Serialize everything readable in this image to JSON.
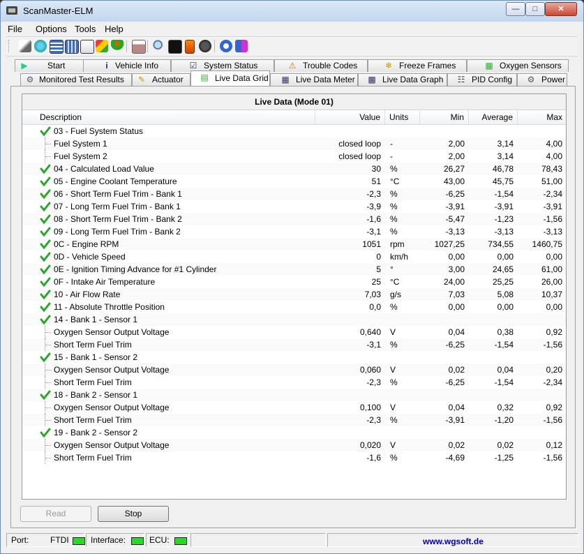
{
  "window": {
    "title": "ScanMaster-ELM"
  },
  "menu": [
    "File",
    "Options",
    "Tools",
    "Help"
  ],
  "toolbar_icons": [
    "connect-icon",
    "globe-icon",
    "grid-icon",
    "table-icon",
    "chart-icon",
    "flag-icon",
    "person-icon",
    "clipboard-icon",
    "zoom-icon",
    "terminal-icon",
    "battery-icon",
    "gauge-icon",
    "info-icon",
    "book-icon"
  ],
  "tabs_top": [
    {
      "label": "Start",
      "icon": "start-icon"
    },
    {
      "label": "Vehicle Info",
      "icon": "info-icon"
    },
    {
      "label": "System Status",
      "icon": "checkbox-icon"
    },
    {
      "label": "Trouble Codes",
      "icon": "warning-icon"
    },
    {
      "label": "Freeze Frames",
      "icon": "snowflake-icon"
    },
    {
      "label": "Oxygen Sensors",
      "icon": "sensor-icon"
    }
  ],
  "tabs_bottom": [
    {
      "label": "Monitored Test Results",
      "icon": "gear-icon"
    },
    {
      "label": "Actuator",
      "icon": "actuator-icon"
    },
    {
      "label": "Live Data Grid",
      "icon": "grid-icon",
      "active": true
    },
    {
      "label": "Live Data Meter",
      "icon": "meter-icon"
    },
    {
      "label": "Live Data Graph",
      "icon": "graph-icon"
    },
    {
      "label": "PID Config",
      "icon": "config-icon"
    },
    {
      "label": "Power",
      "icon": "power-icon"
    }
  ],
  "grid": {
    "title": "Live Data (Mode 01)",
    "columns": {
      "description": "Description",
      "value": "Value",
      "units": "Units",
      "min": "Min",
      "average": "Average",
      "max": "Max"
    },
    "rows": [
      {
        "type": "group",
        "desc": "03 - Fuel System Status",
        "value": "",
        "unit": "",
        "min": "",
        "avg": "",
        "max": ""
      },
      {
        "type": "child",
        "desc": "Fuel System 1",
        "value": "closed loop",
        "unit": "-",
        "min": "2,00",
        "avg": "3,14",
        "max": "4,00"
      },
      {
        "type": "child",
        "desc": "Fuel System 2",
        "value": "closed loop",
        "unit": "-",
        "min": "2,00",
        "avg": "3,14",
        "max": "4,00"
      },
      {
        "type": "group",
        "desc": "04 - Calculated Load Value",
        "value": "30",
        "unit": "%",
        "min": "26,27",
        "avg": "46,78",
        "max": "78,43"
      },
      {
        "type": "group",
        "desc": "05 - Engine Coolant Temperature",
        "value": "51",
        "unit": "°C",
        "min": "43,00",
        "avg": "45,75",
        "max": "51,00"
      },
      {
        "type": "group",
        "desc": "06 - Short Term Fuel Trim - Bank 1",
        "value": "-2,3",
        "unit": "%",
        "min": "-6,25",
        "avg": "-1,54",
        "max": "-2,34"
      },
      {
        "type": "group",
        "desc": "07 - Long Term Fuel Trim - Bank 1",
        "value": "-3,9",
        "unit": "%",
        "min": "-3,91",
        "avg": "-3,91",
        "max": "-3,91"
      },
      {
        "type": "group",
        "desc": "08 - Short Term Fuel Trim - Bank 2",
        "value": "-1,6",
        "unit": "%",
        "min": "-5,47",
        "avg": "-1,23",
        "max": "-1,56"
      },
      {
        "type": "group",
        "desc": "09 - Long Term Fuel Trim - Bank 2",
        "value": "-3,1",
        "unit": "%",
        "min": "-3,13",
        "avg": "-3,13",
        "max": "-3,13"
      },
      {
        "type": "group",
        "desc": "0C - Engine RPM",
        "value": "1051",
        "unit": "rpm",
        "min": "1027,25",
        "avg": "734,55",
        "max": "1460,75"
      },
      {
        "type": "group",
        "desc": "0D - Vehicle Speed",
        "value": "0",
        "unit": "km/h",
        "min": "0,00",
        "avg": "0,00",
        "max": "0,00"
      },
      {
        "type": "group",
        "desc": "0E - Ignition Timing Advance for #1 Cylinder",
        "value": "5",
        "unit": "°",
        "min": "3,00",
        "avg": "24,65",
        "max": "61,00"
      },
      {
        "type": "group",
        "desc": "0F - Intake Air Temperature",
        "value": "25",
        "unit": "°C",
        "min": "24,00",
        "avg": "25,25",
        "max": "26,00"
      },
      {
        "type": "group",
        "desc": "10 - Air Flow Rate",
        "value": "7,03",
        "unit": "g/s",
        "min": "7,03",
        "avg": "5,08",
        "max": "10,37"
      },
      {
        "type": "group",
        "desc": "11 - Absolute Throttle Position",
        "value": "0,0",
        "unit": "%",
        "min": "0,00",
        "avg": "0,00",
        "max": "0,00"
      },
      {
        "type": "group",
        "desc": "14 - Bank 1 - Sensor 1",
        "value": "",
        "unit": "",
        "min": "",
        "avg": "",
        "max": ""
      },
      {
        "type": "child",
        "desc": "Oxygen Sensor Output Voltage",
        "value": "0,640",
        "unit": "V",
        "min": "0,04",
        "avg": "0,38",
        "max": "0,92"
      },
      {
        "type": "child",
        "desc": "Short Term Fuel Trim",
        "value": "-3,1",
        "unit": "%",
        "min": "-6,25",
        "avg": "-1,54",
        "max": "-1,56"
      },
      {
        "type": "group",
        "desc": "15 - Bank 1 - Sensor 2",
        "value": "",
        "unit": "",
        "min": "",
        "avg": "",
        "max": ""
      },
      {
        "type": "child",
        "desc": "Oxygen Sensor Output Voltage",
        "value": "0,060",
        "unit": "V",
        "min": "0,02",
        "avg": "0,04",
        "max": "0,20"
      },
      {
        "type": "child",
        "desc": "Short Term Fuel Trim",
        "value": "-2,3",
        "unit": "%",
        "min": "-6,25",
        "avg": "-1,54",
        "max": "-2,34"
      },
      {
        "type": "group",
        "desc": "18 - Bank 2 - Sensor 1",
        "value": "",
        "unit": "",
        "min": "",
        "avg": "",
        "max": ""
      },
      {
        "type": "child",
        "desc": "Oxygen Sensor Output Voltage",
        "value": "0,100",
        "unit": "V",
        "min": "0,04",
        "avg": "0,32",
        "max": "0,92"
      },
      {
        "type": "child",
        "desc": "Short Term Fuel Trim",
        "value": "-2,3",
        "unit": "%",
        "min": "-3,91",
        "avg": "-1,20",
        "max": "-1,56"
      },
      {
        "type": "group",
        "desc": "19 - Bank 2 - Sensor 2",
        "value": "",
        "unit": "",
        "min": "",
        "avg": "",
        "max": ""
      },
      {
        "type": "child",
        "desc": "Oxygen Sensor Output Voltage",
        "value": "0,020",
        "unit": "V",
        "min": "0,02",
        "avg": "0,02",
        "max": "0,12"
      },
      {
        "type": "child",
        "desc": "Short Term Fuel Trim",
        "value": "-1,6",
        "unit": "%",
        "min": "-4,69",
        "avg": "-1,25",
        "max": "-1,56"
      }
    ]
  },
  "buttons": {
    "read": "Read",
    "stop": "Stop"
  },
  "status": {
    "port_label": "Port:",
    "port_value": "FTDI",
    "interface_label": "Interface:",
    "ecu_label": "ECU:",
    "website": "www.wgsoft.de"
  },
  "colors": {
    "led_green": "#22dd22",
    "check_green": "#2aa52a",
    "link_blue": "#0000b0"
  }
}
